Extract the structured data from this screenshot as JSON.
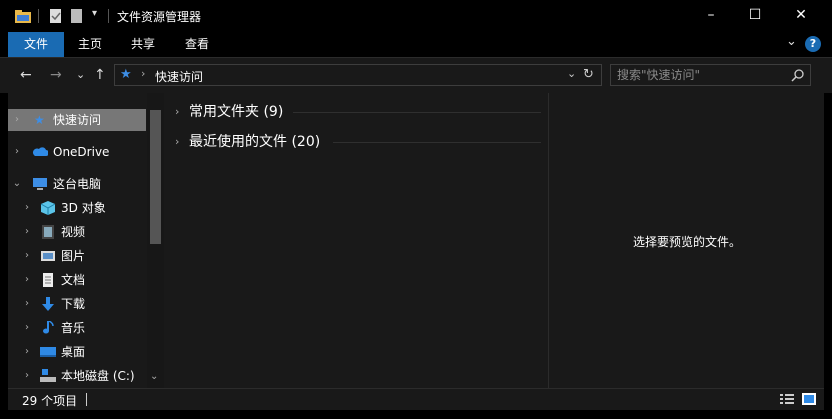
{
  "window": {
    "title": "文件资源管理器",
    "minimize": "–",
    "maximize": "☐",
    "close": "✕"
  },
  "ribbon": {
    "tabs": [
      {
        "label": "文件",
        "active": true
      },
      {
        "label": "主页",
        "active": false
      },
      {
        "label": "共享",
        "active": false
      },
      {
        "label": "查看",
        "active": false
      }
    ],
    "expand": "⌄",
    "help": "?"
  },
  "nav": {
    "back": "←",
    "forward": "→",
    "recent": "⌄",
    "up": "↑",
    "address": "快速访问",
    "search_placeholder": "搜索\"快速访问\""
  },
  "sidebar": {
    "items": [
      {
        "label": "快速访问",
        "icon": "star-icon",
        "selected": true
      },
      {
        "label": "OneDrive",
        "icon": "cloud-icon",
        "selected": false
      },
      {
        "label": "这台电脑",
        "icon": "computer-icon",
        "selected": false,
        "expanded": true
      },
      {
        "label": "3D 对象",
        "icon": "cube-icon"
      },
      {
        "label": "视频",
        "icon": "video-icon"
      },
      {
        "label": "图片",
        "icon": "picture-icon"
      },
      {
        "label": "文档",
        "icon": "document-icon"
      },
      {
        "label": "下载",
        "icon": "download-icon"
      },
      {
        "label": "音乐",
        "icon": "music-icon"
      },
      {
        "label": "桌面",
        "icon": "desktop-icon"
      },
      {
        "label": "本地磁盘 (C:)",
        "icon": "drive-icon"
      }
    ]
  },
  "content": {
    "groups": [
      {
        "label": "常用文件夹 (9)"
      },
      {
        "label": "最近使用的文件 (20)"
      }
    ]
  },
  "preview": {
    "message": "选择要预览的文件。"
  },
  "status": {
    "count": "29 个项目"
  },
  "colors": {
    "accent": "#1a6bb3",
    "background": "#191919",
    "selected": "#777777"
  }
}
